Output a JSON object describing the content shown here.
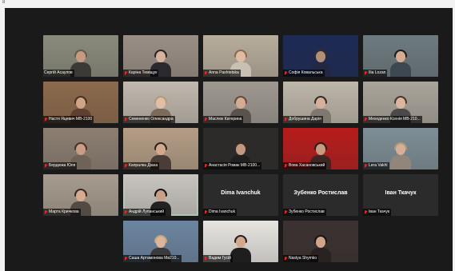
{
  "corner_label": "8",
  "participants": [
    {
      "name": "Сергій Асаулов",
      "row": 0,
      "col": 0,
      "bg": "#8a8a7c",
      "skin": "#c79b83",
      "hair": "#6b5a48",
      "shirt": "#3c3a37",
      "muted": false,
      "video": true
    },
    {
      "name": "Каріна Теміщук",
      "row": 0,
      "col": 1,
      "bg": "#9a8f86",
      "skin": "#d7b29d",
      "hair": "#2e2420",
      "shirt": "#2a2a2e",
      "muted": true,
      "video": true
    },
    {
      "name": "Anna Pashtetska",
      "row": 0,
      "col": 2,
      "bg": "#b7ad9c",
      "skin": "#e1bca5",
      "hair": "#8a6b4c",
      "shirt": "#c8c0b2",
      "muted": true,
      "video": true
    },
    {
      "name": "Софія Ковальська",
      "row": 0,
      "col": 3,
      "bg": "#1c2a55",
      "skin": "#b28f78",
      "hair": "#3b2b20",
      "shirt": "#222844",
      "muted": true,
      "video": true
    },
    {
      "name": "Ilia Lozan",
      "row": 0,
      "col": 4,
      "bg": "#6d7a7f",
      "skin": "#d6ad93",
      "hair": "#1f1a18",
      "shirt": "#3d4752",
      "muted": true,
      "video": true
    },
    {
      "name": "Настя Яцевич МВ-2100",
      "row": 1,
      "col": 0,
      "bg": "#8d6a4c",
      "skin": "#cfa487",
      "hair": "#4a3020",
      "shirt": "#5d4030",
      "muted": true,
      "video": true
    },
    {
      "name": "Семененко Олександра",
      "row": 1,
      "col": 1,
      "bg": "#c0b8ae",
      "skin": "#e1bea7",
      "hair": "#b89a70",
      "shirt": "#7e6a5a",
      "muted": true,
      "video": true
    },
    {
      "name": "Маслюк Катерина",
      "row": 1,
      "col": 2,
      "bg": "#9f9891",
      "skin": "#d4ac94",
      "hair": "#6a4b36",
      "shirt": "#5a524c",
      "muted": true,
      "video": true
    },
    {
      "name": "Добрушина Дарія",
      "row": 1,
      "col": 3,
      "bg": "#bdb6a9",
      "skin": "#d6b09a",
      "hair": "#3b2c25",
      "shirt": "#807770",
      "muted": true,
      "video": true
    },
    {
      "name": "Мехеденко Ксенія МВ-210...",
      "row": 1,
      "col": 4,
      "bg": "#aaa59b",
      "skin": "#dbb59f",
      "hair": "#4e3629",
      "shirt": "#4c4a48",
      "muted": true,
      "video": true
    },
    {
      "name": "Бердюжа Юля",
      "row": 2,
      "col": 0,
      "bg": "#8c7f72",
      "skin": "#c89f86",
      "hair": "#4a3224",
      "shirt": "#6f6257",
      "muted": true,
      "video": true
    },
    {
      "name": "Капралка Діана",
      "row": 2,
      "col": 1,
      "bg": "#b49d86",
      "skin": "#d3a98e",
      "hair": "#2f2420",
      "shirt": "#4a3d35",
      "muted": true,
      "video": true
    },
    {
      "name": "Анастасія Ромак МВ-2100...",
      "row": 2,
      "col": 2,
      "bg": "#2d2b2a",
      "skin": "#c29a82",
      "hair": "#3a2a22",
      "shirt": "#1f1f1f",
      "muted": true,
      "video": true
    },
    {
      "name": "Вова Хасановський",
      "row": 2,
      "col": 3,
      "bg": "#b71c1c",
      "skin": "#c99a7e",
      "hair": "#2a1e18",
      "shirt": "#3b2623",
      "muted": true,
      "video": true
    },
    {
      "name": "Lera Vakhl",
      "row": 2,
      "col": 4,
      "bg": "#7e8e96",
      "skin": "#d4ae96",
      "hair": "#b39875",
      "shirt": "#90867c",
      "muted": true,
      "video": true
    },
    {
      "name": "Марта Кричкова",
      "row": 3,
      "col": 0,
      "bg": "#a69b8e",
      "skin": "#d5ab91",
      "hair": "#3a2a21",
      "shirt": "#534a44",
      "muted": true,
      "video": true
    },
    {
      "name": "Андрій Лупанський",
      "row": 3,
      "col": 1,
      "bg": "#c8c5bf",
      "skin": "#c9a085",
      "hair": "#151515",
      "shirt": "#222222",
      "muted": true,
      "video": true,
      "active": true
    },
    {
      "name": "Dima Ivanchuk",
      "row": 3,
      "col": 2,
      "muted": true,
      "video": false
    },
    {
      "name": "Зубенко Ростислав",
      "row": 3,
      "col": 3,
      "muted": true,
      "video": false
    },
    {
      "name": "Іван Ткачук",
      "row": 3,
      "col": 4,
      "muted": true,
      "video": false
    },
    {
      "name": "Саша Артамонова Мв210...",
      "row": 4,
      "col": 1,
      "bg": "#6c85a0",
      "skin": "#ddb59c",
      "hair": "#c7a67a",
      "shirt": "#3a3a3d",
      "muted": true,
      "video": true
    },
    {
      "name": "Вадим Гусій",
      "row": 4,
      "col": 2,
      "bg": "#e7e4e0",
      "skin": "#d2a98f",
      "hair": "#2a211d",
      "shirt": "#1e1e1e",
      "muted": true,
      "video": true
    },
    {
      "name": "Nastya Shymko",
      "row": 4,
      "col": 3,
      "bg": "#3b3130",
      "skin": "#d0a58b",
      "hair": "#1a1514",
      "shirt": "#2a2220",
      "muted": true,
      "video": true
    }
  ]
}
